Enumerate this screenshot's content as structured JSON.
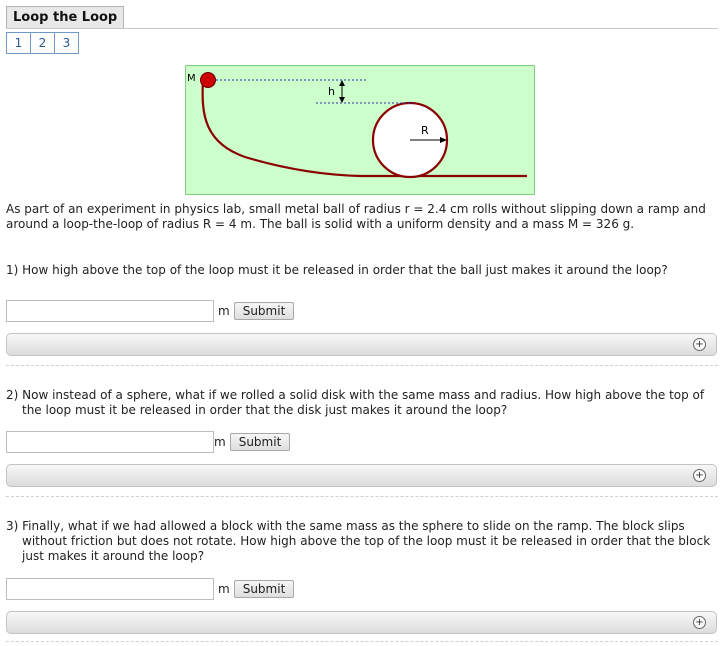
{
  "app": {
    "title": "Loop the Loop"
  },
  "pages": [
    "1",
    "2",
    "3"
  ],
  "figure": {
    "mass_label": "M",
    "height_label": "h",
    "radius_label": "R"
  },
  "intro": "As part of an experiment in physics lab, small metal ball of radius r = 2.4 cm rolls without slipping down a ramp and around a loop-the-loop of radius R = 4 m. The ball is solid with a uniform density and a mass M = 326 g.",
  "questions": [
    {
      "text": "1) How high above the top of the loop must it be released in order that the ball just makes it around the loop?",
      "unit": "m",
      "submit": "Submit",
      "value": ""
    },
    {
      "text": "2) Now instead of a sphere, what if we rolled a solid disk with the same mass and radius. How high above the top of the loop must it be released in order that the disk just makes it around the loop?",
      "unit": "m",
      "submit": "Submit",
      "value": ""
    },
    {
      "text": "3) Finally, what if we had allowed a block with the same mass as the sphere to slide on the ramp. The block slips without friction but does not rotate. How high above the top of the loop must it be released in order that the block just makes it around the loop?",
      "unit": "m",
      "submit": "Submit",
      "value": ""
    }
  ],
  "expand_icon": "+",
  "colors": {
    "figure_bg": "#ccffcc",
    "track": "#8b0000",
    "ball": "#cc0000",
    "link": "#2a5b93"
  }
}
